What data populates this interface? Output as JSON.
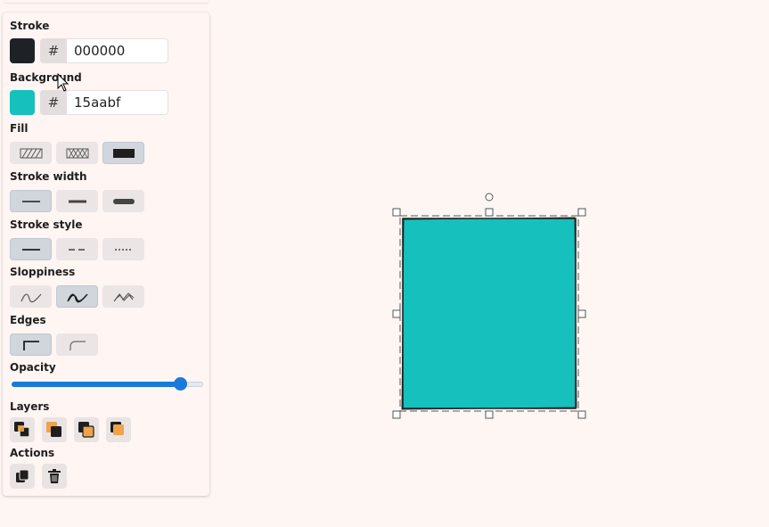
{
  "props": {
    "stroke_label": "Stroke",
    "stroke_hex": "000000",
    "stroke_color": "#1e2226",
    "background_label": "Background",
    "background_hex": "15aabf",
    "background_color": "#15c0bd",
    "hash": "#",
    "fill_label": "Fill",
    "fill_options": [
      "hachure-icon",
      "cross-hatch-icon",
      "solid-fill-icon"
    ],
    "fill_selected": "solid-fill-icon",
    "stroke_width_label": "Stroke width",
    "stroke_width_options": [
      "thin-icon",
      "bold-icon",
      "extra-bold-icon"
    ],
    "stroke_width_selected": "thin-icon",
    "stroke_style_label": "Stroke style",
    "stroke_style_options": [
      "solid-line-icon",
      "dashed-line-icon",
      "dotted-line-icon"
    ],
    "stroke_style_selected": "solid-line-icon",
    "sloppiness_label": "Sloppiness",
    "sloppiness_options": [
      "architect-icon",
      "artist-icon",
      "cartoonist-icon"
    ],
    "sloppiness_selected": "artist-icon",
    "edges_label": "Edges",
    "edges_options": [
      "sharp-edges-icon",
      "round-edges-icon"
    ],
    "edges_selected": "sharp-edges-icon",
    "opacity_label": "Opacity",
    "opacity_value": 0.88,
    "layers_label": "Layers",
    "layers_icons": [
      "send-to-back-icon",
      "send-backward-icon",
      "bring-forward-icon",
      "bring-to-front-icon"
    ],
    "actions_label": "Actions",
    "actions_icons": [
      "duplicate-icon",
      "trash-icon"
    ]
  },
  "canvas": {
    "accent": "#1a7ad9",
    "shape_fill": "#15c0bd",
    "selection_color": "#555555"
  }
}
